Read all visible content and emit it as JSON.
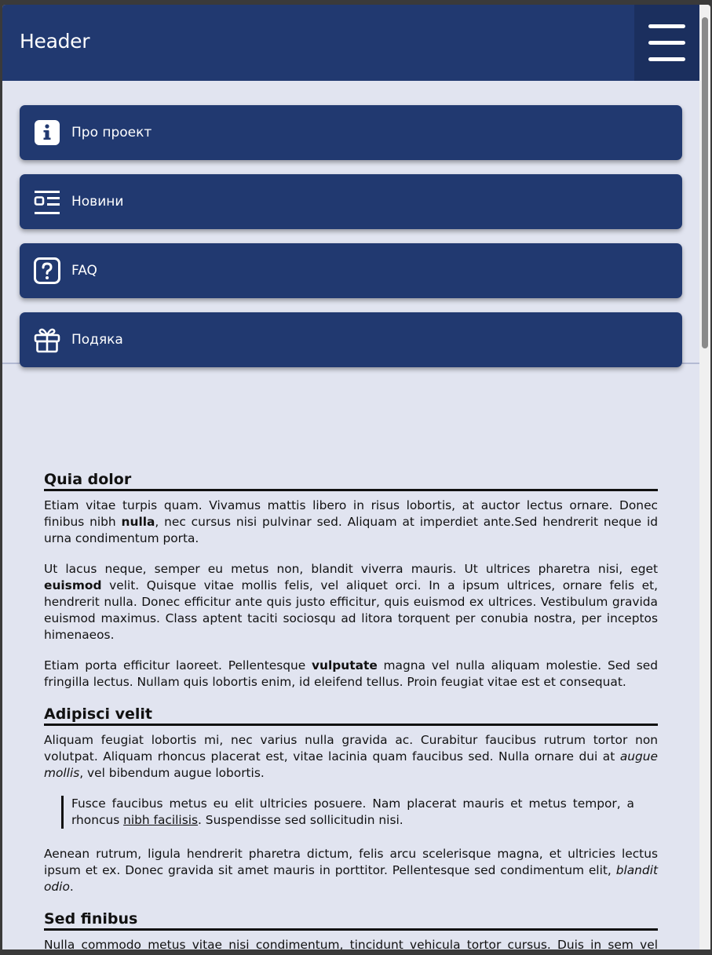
{
  "header": {
    "title": "Header",
    "menu_icon": "hamburger-menu-icon"
  },
  "nav": {
    "items": [
      {
        "label": "Про проект",
        "icon": "info-icon"
      },
      {
        "label": "Новини",
        "icon": "news-icon"
      },
      {
        "label": "FAQ",
        "icon": "question-icon"
      },
      {
        "label": "Подяка",
        "icon": "gift-icon"
      }
    ]
  },
  "article": {
    "s1": {
      "heading": "Quia dolor",
      "p1a": "Etiam vitae turpis quam. Vivamus mattis libero in risus lobortis, at auctor lectus ornare. Donec finibus nibh ",
      "p1b": "nulla",
      "p1c": ", nec cursus nisi pulvinar sed. Aliquam at imperdiet ante.Sed hendrerit neque id urna condimentum porta.",
      "p2a": "Ut lacus neque, semper eu metus non, blandit viverra mauris. Ut ultrices pharetra nisi, eget ",
      "p2b": "euismod",
      "p2c": " velit. Quisque vitae mollis felis, vel aliquet orci. In a ipsum ultrices, ornare felis et, hendrerit nulla. Donec efficitur ante quis justo efficitur, quis euismod ex ultrices. Vestibulum gravida euismod maximus. Class aptent taciti sociosqu ad litora torquent per conubia nostra, per inceptos himenaeos.",
      "p3a": "Etiam porta efficitur laoreet. Pellentesque ",
      "p3b": "vulputate",
      "p3c": " magna vel nulla aliquam molestie. Sed sed fringilla lectus. Nullam quis lobortis enim, id eleifend tellus. Proin feugiat vitae est et consequat."
    },
    "s2": {
      "heading": "Adipisci velit",
      "p1a": "Aliquam feugiat lobortis mi, nec varius nulla gravida ac. Curabitur faucibus rutrum tortor non volutpat. Aliquam rhoncus placerat est, vitae lacinia quam faucibus sed. Nulla ornare dui at ",
      "p1b": "augue mollis",
      "p1c": ", vel bibendum augue lobortis.",
      "q1a": "Fusce faucibus metus eu elit ultricies posuere. Nam placerat mauris et metus tempor, a rhoncus ",
      "q1b": "nibh facilisis",
      "q1c": ". Suspendisse sed sollicitudin nisi.",
      "p2a": "Aenean rutrum, ligula hendrerit pharetra dictum, felis arcu scelerisque magna, et ultricies lectus ipsum et ex. Donec gravida sit amet mauris in porttitor. Pellentesque sed condimentum elit, ",
      "p2b": "blandit odio",
      "p2c": "."
    },
    "s3": {
      "heading": "Sed finibus",
      "p1": "Nulla commodo metus vitae nisi condimentum, tincidunt vehicula tortor cursus. Duis in sem vel ipsum"
    }
  },
  "colors": {
    "header_bg": "#213970",
    "nav_bg": "#213970",
    "page_bg": "#e1e4f0"
  }
}
